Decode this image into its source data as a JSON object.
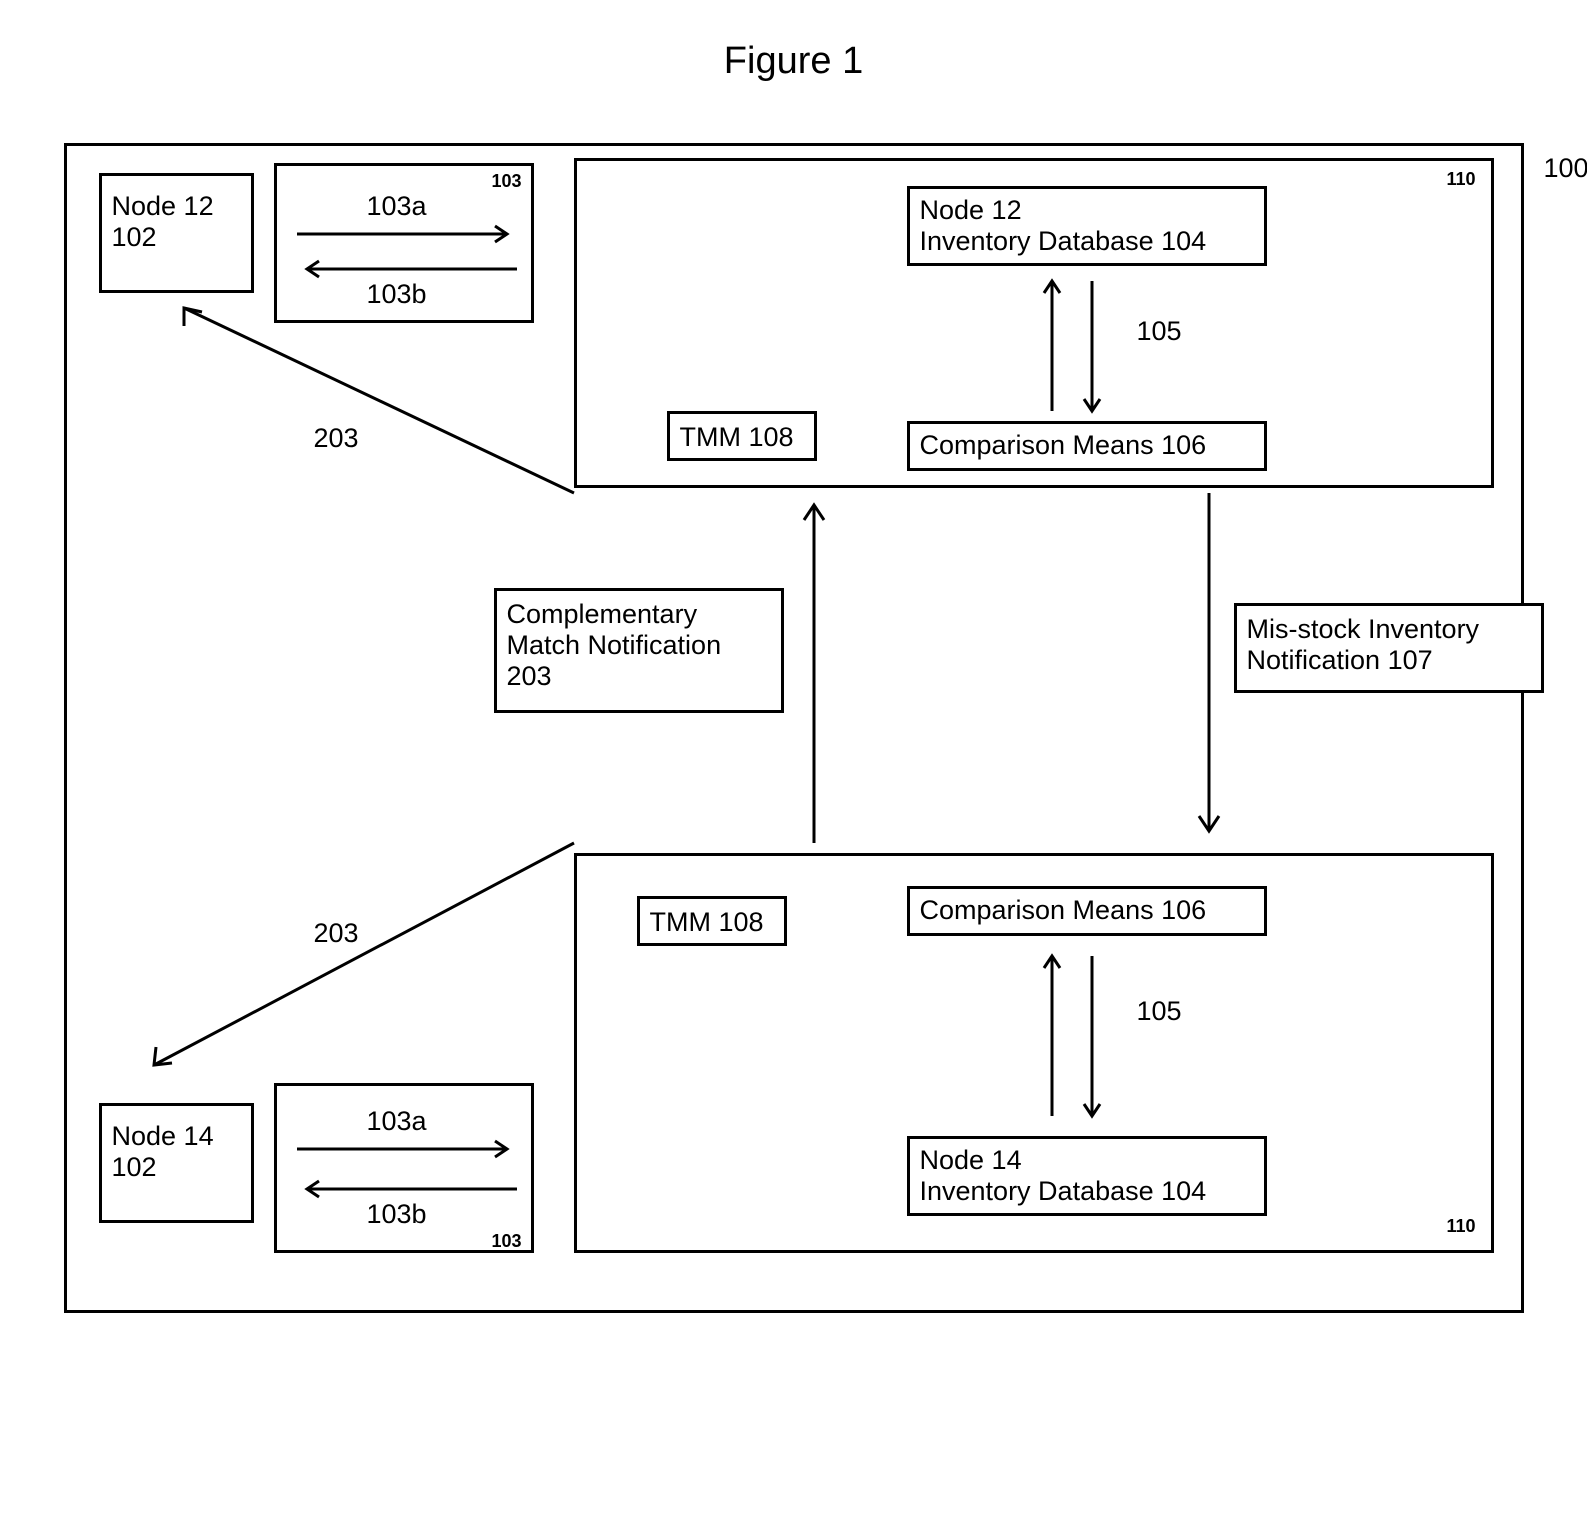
{
  "figure_title": "Figure 1",
  "outer_label": "100",
  "node12": {
    "label_l1": "Node 12",
    "label_l2": "102"
  },
  "node14": {
    "label_l1": "Node 14",
    "label_l2": "102"
  },
  "comm_box_top": {
    "label_103a": "103a",
    "label_103b": "103b",
    "corner": "103"
  },
  "comm_box_bottom": {
    "label_103a": "103a",
    "label_103b": "103b",
    "corner": "103"
  },
  "edge_203_top": "203",
  "edge_203_bottom": "203",
  "complementary": {
    "l1": "Complementary",
    "l2": "Match Notification",
    "l3": "203"
  },
  "misstock": {
    "l1": "Mis-stock Inventory",
    "l2": "Notification 107"
  },
  "upper_unit": {
    "corner": "110",
    "tmm": "TMM 108",
    "inv_l1": "Node 12",
    "inv_l2": "Inventory Database 104",
    "comp": "Comparison Means 106",
    "edge_105": "105"
  },
  "lower_unit": {
    "corner": "110",
    "tmm": "TMM 108",
    "inv_l1": "Node 14",
    "inv_l2": "Inventory Database 104",
    "comp": "Comparison Means 106",
    "edge_105": "105"
  }
}
